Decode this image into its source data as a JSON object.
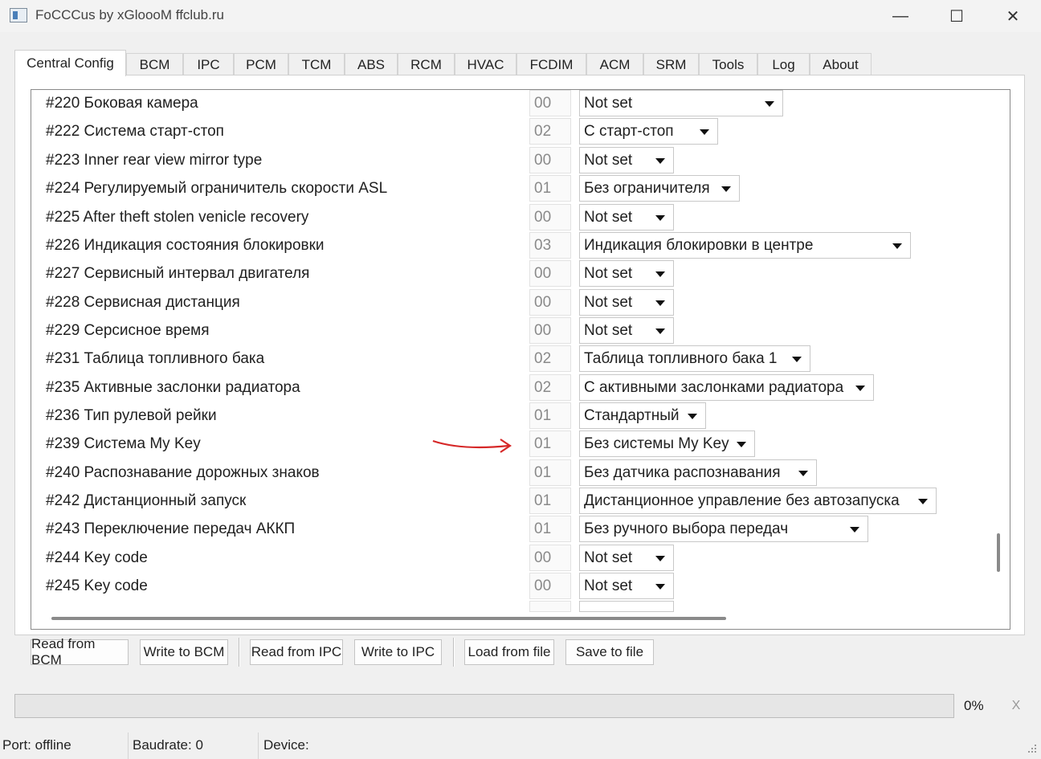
{
  "window": {
    "title": "FoCCCus by xGloooM ffclub.ru",
    "minimize_glyph": "—",
    "maximize_glyph": "☐",
    "close_glyph": "✕"
  },
  "tabs": [
    {
      "label": "Central Config",
      "active": true
    },
    {
      "label": "BCM"
    },
    {
      "label": "IPC"
    },
    {
      "label": "PCM"
    },
    {
      "label": "TCM"
    },
    {
      "label": "ABS"
    },
    {
      "label": "RCM"
    },
    {
      "label": "HVAC"
    },
    {
      "label": "FCDIM"
    },
    {
      "label": "ACM"
    },
    {
      "label": "SRM"
    },
    {
      "label": "Tools"
    },
    {
      "label": "Log"
    },
    {
      "label": "About"
    }
  ],
  "rows": [
    {
      "label": "#220  Боковая камера",
      "code": "00",
      "value": "Not set"
    },
    {
      "label": "#222  Система старт-стоп",
      "code": "02",
      "value": "С старт-стоп"
    },
    {
      "label": "#223  Inner rear view mirror type",
      "code": "00",
      "value": "Not set"
    },
    {
      "label": "#224  Регулируемый ограничитель скорости ASL",
      "code": "01",
      "value": "Без ограничителя"
    },
    {
      "label": "#225  After theft stolen venicle recovery",
      "code": "00",
      "value": "Not set"
    },
    {
      "label": "#226  Индикация состояния блокировки",
      "code": "03",
      "value": "Индикация блокировки в центре"
    },
    {
      "label": "#227  Сервисный интервал двигателя",
      "code": "00",
      "value": "Not set"
    },
    {
      "label": "#228  Сервисная дистанция",
      "code": "00",
      "value": "Not set"
    },
    {
      "label": "#229  Серсисное время",
      "code": "00",
      "value": "Not set"
    },
    {
      "label": "#231  Таблица топливного бака",
      "code": "02",
      "value": "Таблица топливного бака 1"
    },
    {
      "label": "#235  Активные заслонки радиатора",
      "code": "02",
      "value": "С активными заслонками радиатора"
    },
    {
      "label": "#236  Тип рулевой рейки",
      "code": "01",
      "value": "Стандартный"
    },
    {
      "label": "#239  Система My Key",
      "code": "01",
      "value": "Без системы My Key"
    },
    {
      "label": "#240  Распознавание дорожных знаков",
      "code": "01",
      "value": "Без датчика распознавания"
    },
    {
      "label": "#242  Дистанционный запуск",
      "code": "01",
      "value": "Дистанционное управление без автозапуска"
    },
    {
      "label": "#243  Переключение передач АККП",
      "code": "01",
      "value": "Без ручного выбора передач"
    },
    {
      "label": "#244  Key code",
      "code": "00",
      "value": "Not set"
    },
    {
      "label": "#245  Key code",
      "code": "00",
      "value": "Not set"
    }
  ],
  "buttons": {
    "read_bcm": "Read from BCM",
    "write_bcm": "Write to BCM",
    "read_ipc": "Read from IPC",
    "write_ipc": "Write to IPC",
    "load_file": "Load from file",
    "save_file": "Save to file"
  },
  "progress": {
    "value_percent": 0,
    "text": "0%",
    "cancel_label": "X"
  },
  "status": {
    "port": "Port: offline",
    "baudrate": "Baudrate: 0",
    "device": "Device:"
  },
  "colors": {
    "annotation_arrow": "#d62828",
    "tab_active_bg": "#ffffff",
    "window_bg": "#f0f0f0"
  }
}
